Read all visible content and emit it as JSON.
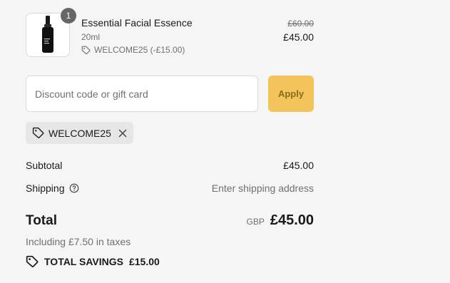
{
  "line_item": {
    "quantity": "1",
    "name": "Essential Facial Essence",
    "variant": "20ml",
    "discount": "WELCOME25 (-£15.00)",
    "price_original": "£60.00",
    "price_current": "£45.00"
  },
  "discount_form": {
    "placeholder": "Discount code or gift card",
    "apply_label": "Apply",
    "accent_color": "#f2c45a"
  },
  "applied_code": {
    "code": "WELCOME25",
    "icon": "tag-icon"
  },
  "summary": {
    "subtotal_label": "Subtotal",
    "subtotal_value": "£45.00",
    "shipping_label": "Shipping",
    "shipping_value": "Enter shipping address",
    "total_label": "Total",
    "currency": "GBP",
    "total_value": "£45.00",
    "taxes_text": "Including £7.50 in taxes",
    "savings_label": "TOTAL SAVINGS",
    "savings_value": "£15.00"
  }
}
